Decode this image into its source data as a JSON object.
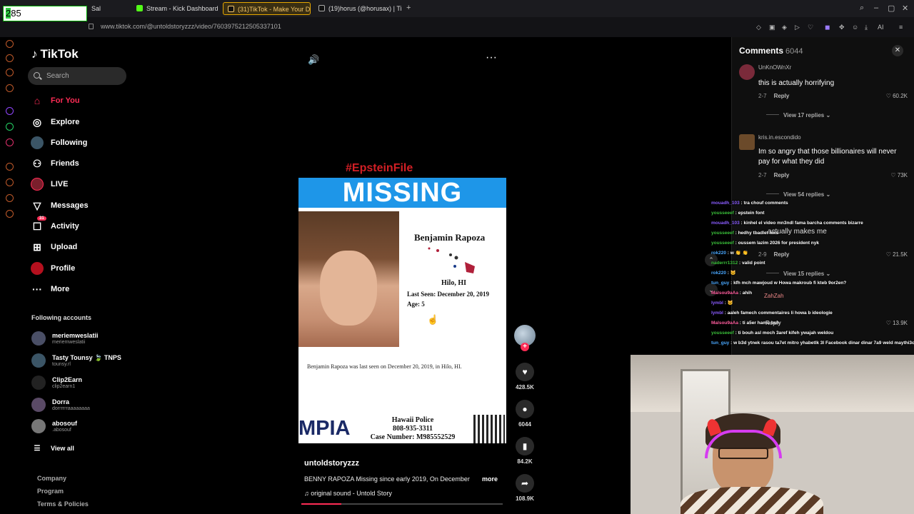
{
  "overlay": {
    "counter_prefix": "2",
    "counter_rest": "85"
  },
  "browser": {
    "tabs": [
      {
        "label": "Sal",
        "active": false
      },
      {
        "label": "Stream - Kick Dashboard",
        "active": false
      },
      {
        "label": "(31)TikTok - Make Your D",
        "active": true
      },
      {
        "label": "(19)horus (@horusax) | Ti",
        "active": false
      }
    ],
    "url": "www.tiktok.com/@untoldstoryzzz/video/7603975212505337101",
    "ai_label": "AI"
  },
  "sidebar": {
    "brand": "TikTok",
    "search_placeholder": "Search",
    "nav": [
      {
        "label": "For You",
        "icon": "home-icon",
        "active": true
      },
      {
        "label": "Explore",
        "icon": "compass-icon",
        "active": false
      },
      {
        "label": "Following",
        "icon": "following-avatar-icon",
        "active": false
      },
      {
        "label": "Friends",
        "icon": "friends-icon",
        "active": false
      },
      {
        "label": "LIVE",
        "icon": "live-icon",
        "active": false
      },
      {
        "label": "Messages",
        "icon": "messages-icon",
        "active": false
      },
      {
        "label": "Activity",
        "icon": "activity-icon",
        "badge": "31",
        "active": false
      },
      {
        "label": "Upload",
        "icon": "upload-icon",
        "active": false
      },
      {
        "label": "Profile",
        "icon": "profile-icon",
        "active": false
      },
      {
        "label": "More",
        "icon": "more-icon",
        "active": false
      }
    ],
    "following_title": "Following accounts",
    "accounts": [
      {
        "name": "meriemweslatii",
        "handle": "meriemweslatii"
      },
      {
        "name": "Tasty Tounsy 🍃 TNPS",
        "handle": "tounsy.rl"
      },
      {
        "name": "Clip2Earn",
        "handle": "clip2earn1"
      },
      {
        "name": "Dorra",
        "handle": "dorrrrrraaaaaaaa"
      },
      {
        "name": "abosouf",
        "handle": ".abosouf"
      }
    ],
    "view_all": "View all",
    "footer": [
      "Company",
      "Program",
      "Terms & Policies"
    ]
  },
  "video": {
    "hashtag": "#EpsteinFile",
    "poster": {
      "banner": "MISSING",
      "name": "Benjamin Rapoza",
      "city": "Hilo, HI",
      "last_seen": "Last Seen: December 20, 2019",
      "age": "Age: 5",
      "description": "Benjamin Rapoza was last seen on December 20, 2019, in Hilo, HI.",
      "org": "MPIA",
      "police_name": "Hawaii Police",
      "police_phone": "808-935-3311",
      "case": "Case Number: M985552529"
    },
    "author": "untoldstoryzzz",
    "description": "BENNY RAPOZA Missing since early 2019, On December",
    "more_label": "more",
    "sound": "original sound - Untold Story",
    "progress": 0.2,
    "actions": {
      "likes": "428.5K",
      "comments": "6044",
      "saves": "84.2K",
      "shares": "108.9K"
    }
  },
  "comments": {
    "title": "Comments",
    "count": "6044",
    "items": [
      {
        "user": "UnKnOWnXr",
        "text": "this is actually horrifying",
        "date": "2-7",
        "reply": "Reply",
        "likes": "60.2K",
        "replies": "View 17 replies"
      },
      {
        "user": "kris.in.escondido",
        "text": "Im so angry that those billionaires will never pay for what they did",
        "date": "2-7",
        "reply": "Reply",
        "likes": "73K",
        "replies": "View 54 replies"
      },
      {
        "user": "",
        "text": "actually makes me",
        "date": "2-9",
        "reply": "Reply",
        "likes": "21.5K",
        "replies": "View 15 replies"
      },
      {
        "user": "ZahZah",
        "text": "",
        "date": "",
        "reply": "Reply",
        "likes": "13.9K",
        "replies": ""
      }
    ]
  },
  "chat": [
    {
      "user": "mouadh_103",
      "msg": "tra chouf comments",
      "cls": "u1"
    },
    {
      "user": "yousseeef",
      "msg": "epstein font",
      "cls": "u2"
    },
    {
      "user": "mouadh_103",
      "msg": "kinhel el video mn3ndl fama barcha comments bizarre",
      "cls": "u1"
    },
    {
      "user": "yousseeef",
      "msg": "hedhy tbadlet leks",
      "cls": "u2"
    },
    {
      "user": "yousseeef",
      "msg": "oussem lazim 2026 for president nyk",
      "cls": "u2"
    },
    {
      "user": "rok220",
      "msg": "w 👏 👏",
      "cls": "u4"
    },
    {
      "user": "naderrr1312",
      "msg": "valid point",
      "cls": "u2"
    },
    {
      "user": "rok220",
      "msg": "🐱",
      "cls": "u4"
    },
    {
      "user": "tun_guy",
      "msg": "kfh mch mawjoud w Howa makroub fi kteb 9or2en?",
      "cls": "u4"
    },
    {
      "user": "Malsou9aAa",
      "msg": "ahih",
      "cls": "u3"
    },
    {
      "user": "lymbl",
      "msg": "🐱",
      "cls": "u1"
    },
    {
      "user": "lymbl",
      "msg": "aaleh famech commentaires li howa b ideologie",
      "cls": "u1"
    },
    {
      "user": "Malsou9aAa",
      "msg": "ti a5er hamu buh",
      "cls": "u3"
    },
    {
      "user": "yousseeef",
      "msg": "ti bouh asl moch 3aref kifeh ywajah weldou",
      "cls": "u2"
    },
    {
      "user": "tun_guy",
      "msg": "w b3d ytnek rasou ta7et mitro yhabetlk 3l Facebook dinar dinar 7a9 weld maythi3ch",
      "cls": "u4"
    }
  ]
}
